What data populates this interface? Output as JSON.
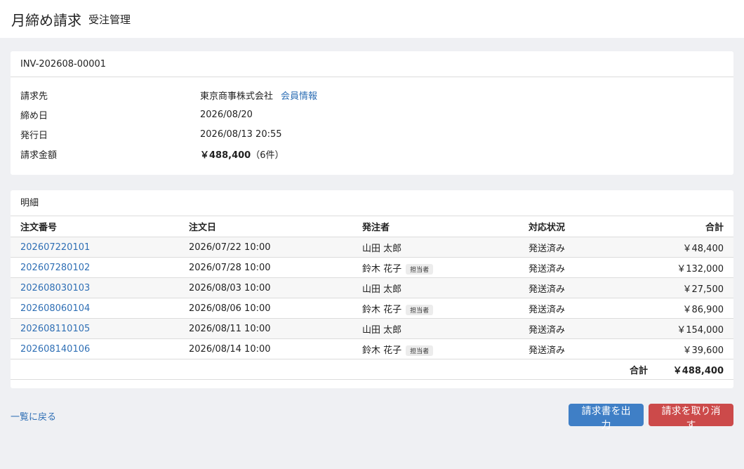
{
  "header": {
    "title": "月締め請求",
    "subtitle": "受注管理"
  },
  "invoice": {
    "id": "INV-202608-00001",
    "fields": {
      "billing_to_label": "請求先",
      "billing_to_value": "東京商事株式会社",
      "member_link": "会員情報",
      "closing_date_label": "締め日",
      "closing_date_value": "2026/08/20",
      "issue_date_label": "発行日",
      "issue_date_value": "2026/08/13 20:55",
      "amount_label": "請求金額",
      "amount_value": "￥488,400",
      "amount_count": "（6件）"
    }
  },
  "details": {
    "title": "明細",
    "columns": [
      "注文番号",
      "注文日",
      "発注者",
      "対応状況",
      "合計"
    ],
    "rows": [
      {
        "order": "202607220101",
        "date": "2026/07/22 10:00",
        "person": "山田 太郎",
        "badge": "",
        "status": "発送済み",
        "total": "￥48,400"
      },
      {
        "order": "202607280102",
        "date": "2026/07/28 10:00",
        "person": "鈴木 花子",
        "badge": "担当者",
        "status": "発送済み",
        "total": "￥132,000"
      },
      {
        "order": "202608030103",
        "date": "2026/08/03 10:00",
        "person": "山田 太郎",
        "badge": "",
        "status": "発送済み",
        "total": "￥27,500"
      },
      {
        "order": "202608060104",
        "date": "2026/08/06 10:00",
        "person": "鈴木 花子",
        "badge": "担当者",
        "status": "発送済み",
        "total": "￥86,900"
      },
      {
        "order": "202608110105",
        "date": "2026/08/11 10:00",
        "person": "山田 太郎",
        "badge": "",
        "status": "発送済み",
        "total": "￥154,000"
      },
      {
        "order": "202608140106",
        "date": "2026/08/14 10:00",
        "person": "鈴木 花子",
        "badge": "担当者",
        "status": "発送済み",
        "total": "￥39,600"
      }
    ],
    "total_label": "合計",
    "total_value": "￥488,400"
  },
  "footer": {
    "back_link": "一覧に戻る",
    "export_button": "請求書を出力",
    "cancel_button": "請求を取り消す"
  }
}
